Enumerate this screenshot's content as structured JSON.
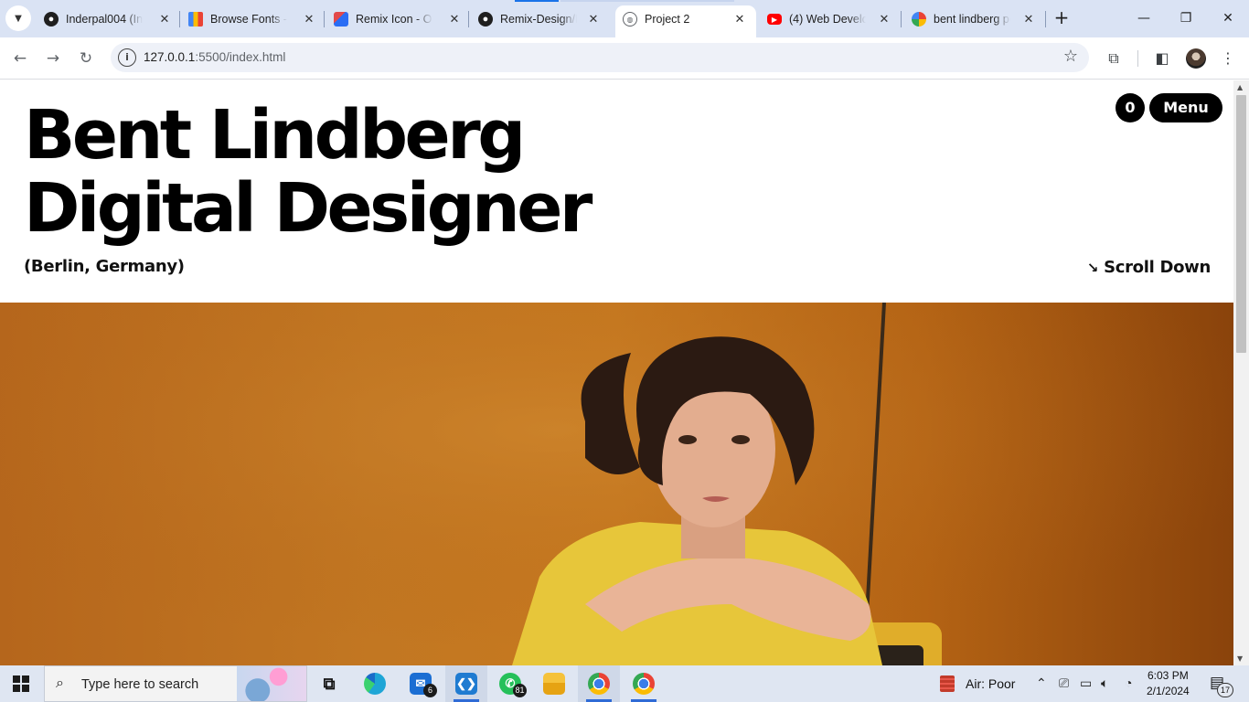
{
  "browser": {
    "tabs": [
      {
        "title": "Inderpal004 (Ind",
        "icon": "github-icon"
      },
      {
        "title": "Browse Fonts - G",
        "icon": "google-fonts-icon"
      },
      {
        "title": "Remix Icon - Op",
        "icon": "remix-icon"
      },
      {
        "title": "Remix-Design/R",
        "icon": "github-icon"
      },
      {
        "title": "Project 2",
        "icon": "globe-icon",
        "active": true
      },
      {
        "title": "(4) Web Develop",
        "icon": "youtube-icon"
      },
      {
        "title": "bent lindberg po",
        "icon": "google-icon"
      }
    ],
    "url_host": "127.0.0.1",
    "url_path": ":5500/index.html"
  },
  "page": {
    "title_line1": "Bent Lindberg",
    "title_line2": "Digital Designer",
    "location": "(Berlin, Germany)",
    "scroll_label": "Scroll Down",
    "cart_count": "0",
    "menu_label": "Menu"
  },
  "taskbar": {
    "search_placeholder": "Type here to search",
    "mail_badge": "6",
    "whatsapp_badge": "81",
    "air_quality": "Air: Poor",
    "time": "6:03 PM",
    "date": "2/1/2024",
    "notification_count": "17"
  },
  "colors": {
    "chrome_tab_strip": "#dae3f4",
    "hero_orange": "#c27722",
    "text_black": "#000000"
  }
}
